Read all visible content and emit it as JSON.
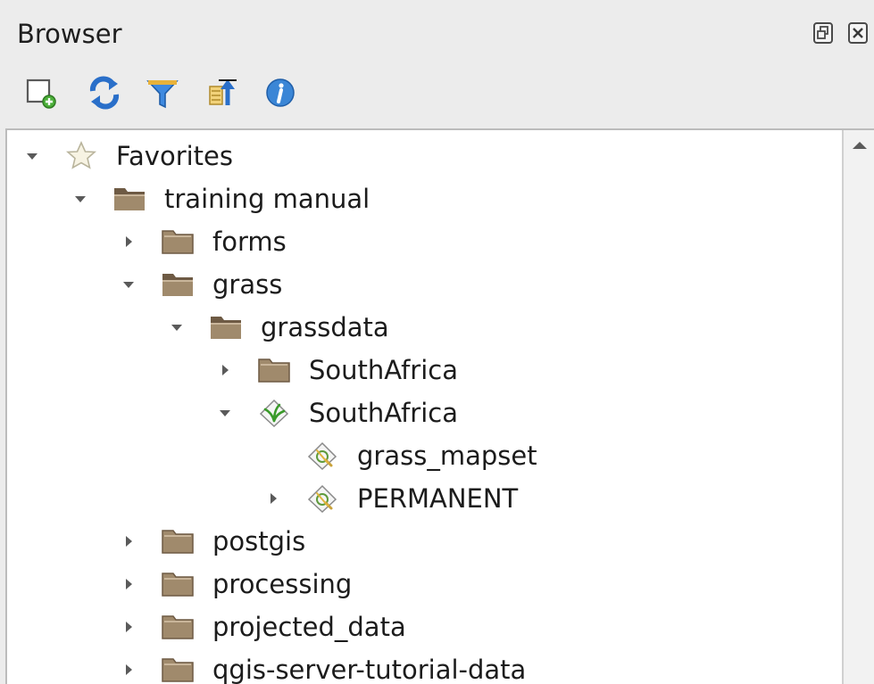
{
  "panel": {
    "title": "Browser"
  },
  "title_buttons": [
    {
      "name": "float-panel-button",
      "icon": "float-icon"
    },
    {
      "name": "close-panel-button",
      "icon": "close-icon"
    }
  ],
  "toolbar": {
    "buttons": [
      {
        "name": "add-selected-layers-button",
        "icon": "add-layer-icon"
      },
      {
        "name": "refresh-button",
        "icon": "refresh-icon"
      },
      {
        "name": "filter-button",
        "icon": "filter-icon"
      },
      {
        "name": "collapse-all-button",
        "icon": "collapse-all-icon"
      },
      {
        "name": "properties-button",
        "icon": "info-icon"
      }
    ]
  },
  "tree": {
    "items": [
      {
        "label": "Favorites",
        "depth": 0,
        "expanded": true,
        "icon": "star-icon",
        "has_children": true
      },
      {
        "label": "training manual",
        "depth": 1,
        "expanded": true,
        "icon": "folder-open-icon",
        "has_children": true
      },
      {
        "label": "forms",
        "depth": 2,
        "expanded": false,
        "icon": "folder-icon",
        "has_children": true
      },
      {
        "label": "grass",
        "depth": 2,
        "expanded": true,
        "icon": "folder-open-icon",
        "has_children": true
      },
      {
        "label": "grassdata",
        "depth": 3,
        "expanded": true,
        "icon": "folder-open-icon",
        "has_children": true
      },
      {
        "label": "SouthAfrica",
        "depth": 4,
        "expanded": false,
        "icon": "folder-icon",
        "has_children": true
      },
      {
        "label": "SouthAfrica",
        "depth": 4,
        "expanded": true,
        "icon": "grass-location-icon",
        "has_children": true
      },
      {
        "label": "grass_mapset",
        "depth": 5,
        "expanded": false,
        "icon": "grass-mapset-icon",
        "has_children": false
      },
      {
        "label": "PERMANENT",
        "depth": 5,
        "expanded": false,
        "icon": "grass-mapset-icon",
        "has_children": true
      },
      {
        "label": "postgis",
        "depth": 2,
        "expanded": false,
        "icon": "folder-icon",
        "has_children": true
      },
      {
        "label": "processing",
        "depth": 2,
        "expanded": false,
        "icon": "folder-icon",
        "has_children": true
      },
      {
        "label": "projected_data",
        "depth": 2,
        "expanded": false,
        "icon": "folder-icon",
        "has_children": true
      },
      {
        "label": "qgis-server-tutorial-data",
        "depth": 2,
        "expanded": false,
        "icon": "folder-icon",
        "has_children": true
      }
    ]
  },
  "colors": {
    "panel_bg": "#ececec",
    "tree_bg": "#ffffff",
    "folder": "#a08a6c",
    "folder_dark": "#6e5a44",
    "refresh_blue": "#2a6fc9",
    "info_blue": "#3b86d6",
    "green": "#3a9a2a"
  }
}
